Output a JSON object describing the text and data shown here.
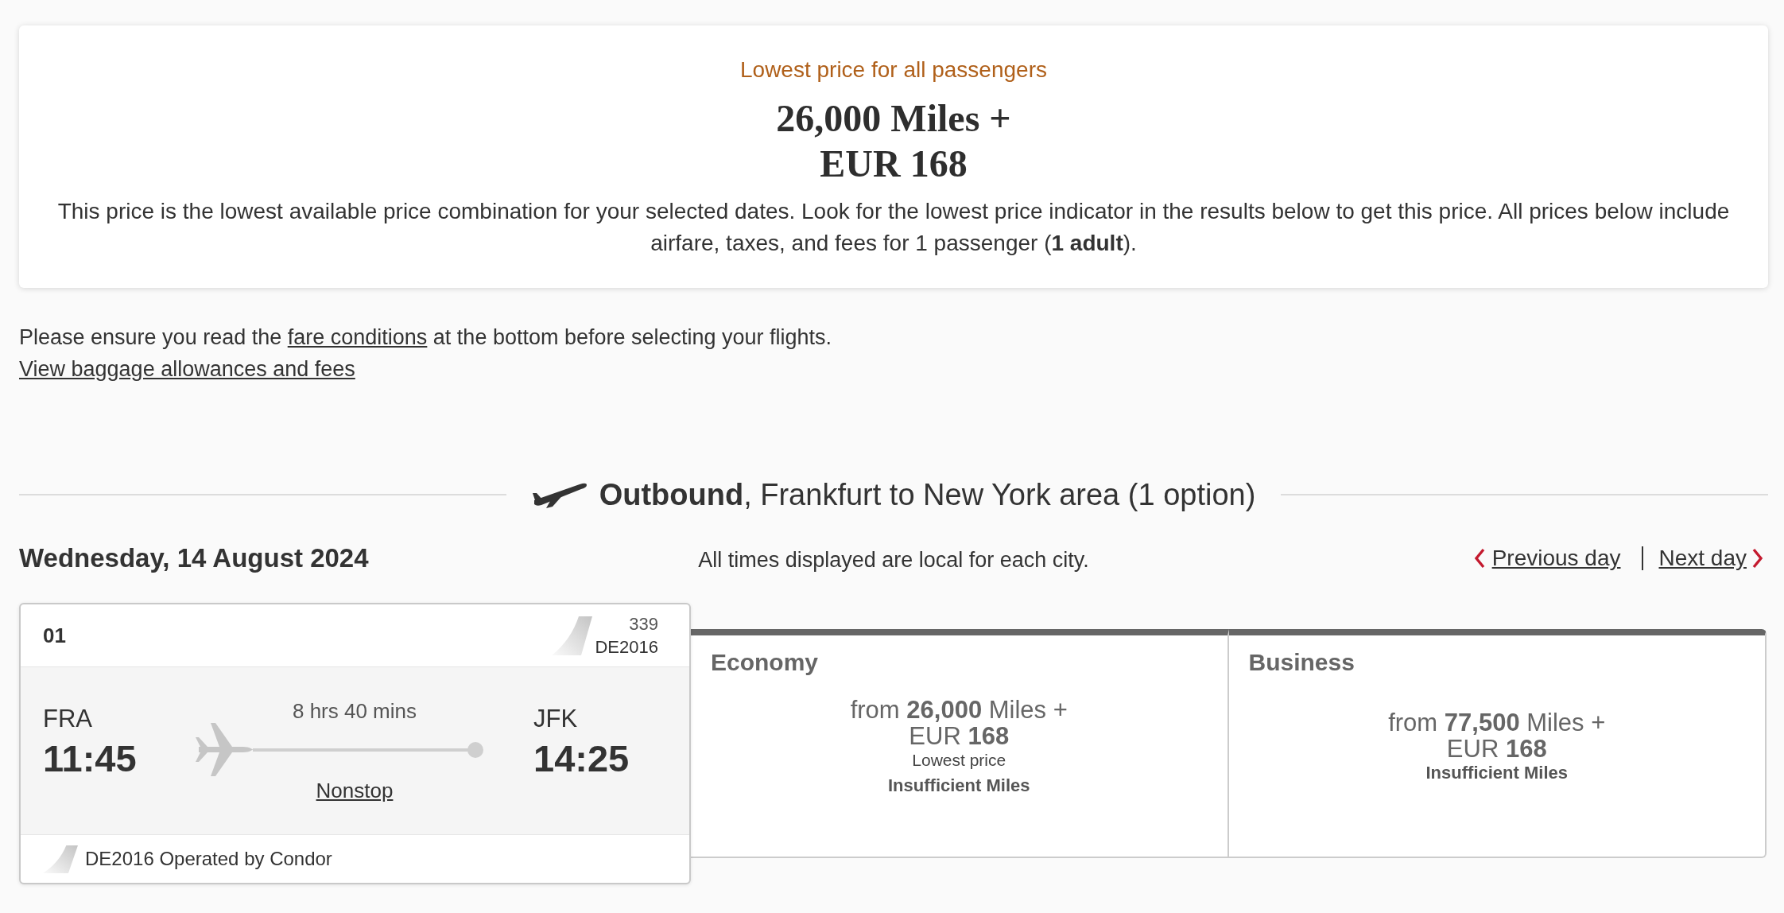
{
  "price_summary": {
    "heading": "Lowest price for all passengers",
    "price_lines": [
      "26,000 Miles +",
      "EUR 168"
    ],
    "description": "This price is the lowest available price combination for your selected dates. Look for the lowest price indicator in the results below to get this price. All prices below include airfare, taxes, and fees for 1 passenger (**1 adult**)."
  },
  "notice": {
    "text_before": "Please ensure you read the",
    "link": "fare conditions",
    "text_after": "at the bottom before selecting your flights."
  },
  "baggage_link": "View baggage allowances and fees",
  "outbound": {
    "heading": "**Outbound**, Frankfurt to New York area (1 option)",
    "date": "Wednesday, 14 August 2024",
    "times_note": "All times displayed are local for each city.",
    "day_nav": [
      {
        "kind": "previous",
        "label": "Previous day"
      },
      {
        "kind": "next",
        "label": "Next day"
      }
    ],
    "flights": [
      {
        "number": "01",
        "aircraft": "339",
        "flight_code": "DE2016",
        "origin": {
          "code": "FRA",
          "time": "11:45"
        },
        "duration": "8 hrs 40 mins",
        "stops": "Nonstop",
        "destination": {
          "code": "JFK",
          "time": "14:25"
        },
        "operator": "DE2016 Operated by Condor",
        "fares": [
          {
            "cabin": "Economy",
            "price_lines": [
              "from **26,000** Miles +",
              "EUR **168**"
            ],
            "badge": "Lowest price",
            "status": "Insufficient Miles"
          },
          {
            "cabin": "Business",
            "price_lines": [
              "from **77,500** Miles +",
              "EUR **168**"
            ],
            "status": "Insufficient Miles"
          }
        ]
      }
    ]
  }
}
